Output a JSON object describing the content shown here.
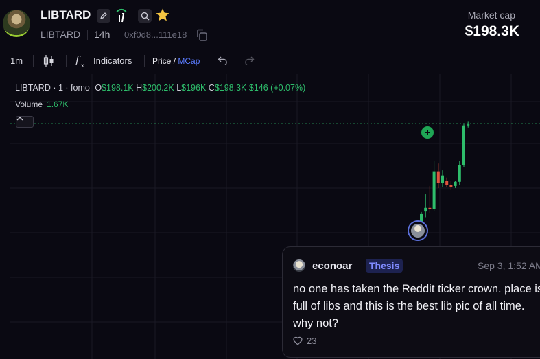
{
  "header": {
    "token_name": "LIBTARD",
    "ticker": "LIBTARD",
    "age": "14h",
    "address": "0xf0d8...111e18",
    "market_cap_label": "Market cap",
    "market_cap_value": "$198.3K"
  },
  "toolbar": {
    "interval": "1m",
    "indicators_label": "Indicators",
    "price_label": "Price",
    "slash": "/",
    "mcap_label": "MCap"
  },
  "chart": {
    "legend_title": "LIBTARD · 1 · fomo",
    "open_key": "O",
    "open": "$198.1K",
    "high_key": "H",
    "high": "$200.2K",
    "low_key": "L",
    "low": "$196K",
    "close_key": "C",
    "close": "$198.3K",
    "change": "$146 (+0.07%)",
    "volume_label": "Volume",
    "volume_value": "1.67K",
    "up_color": "#2ebd6b",
    "down_color": "#e0533d",
    "candles": [
      {
        "o": 40,
        "h": 62,
        "l": 36,
        "c": 58
      },
      {
        "o": 63,
        "h": 96,
        "l": 52,
        "c": 70
      },
      {
        "o": 70,
        "h": 112,
        "l": 60,
        "c": 68
      },
      {
        "o": 68,
        "h": 160,
        "l": 64,
        "c": 140
      },
      {
        "o": 140,
        "h": 155,
        "l": 108,
        "c": 118
      },
      {
        "o": 118,
        "h": 142,
        "l": 110,
        "c": 132
      },
      {
        "o": 122,
        "h": 128,
        "l": 110,
        "c": 114
      },
      {
        "o": 114,
        "h": 122,
        "l": 104,
        "c": 110
      },
      {
        "o": 112,
        "h": 122,
        "l": 108,
        "c": 120
      },
      {
        "o": 120,
        "h": 160,
        "l": 114,
        "c": 152
      },
      {
        "o": 152,
        "h": 232,
        "l": 148,
        "c": 228
      },
      {
        "o": 228,
        "h": 235,
        "l": 224,
        "c": 230
      }
    ]
  },
  "comment": {
    "user": "econoar",
    "tag": "Thesis",
    "time": "Sep 3, 1:52 AM",
    "text": "no one has taken the Reddit ticker crown. place is full of libs and this is the best lib pic of all time. why not?",
    "likes": "23"
  }
}
